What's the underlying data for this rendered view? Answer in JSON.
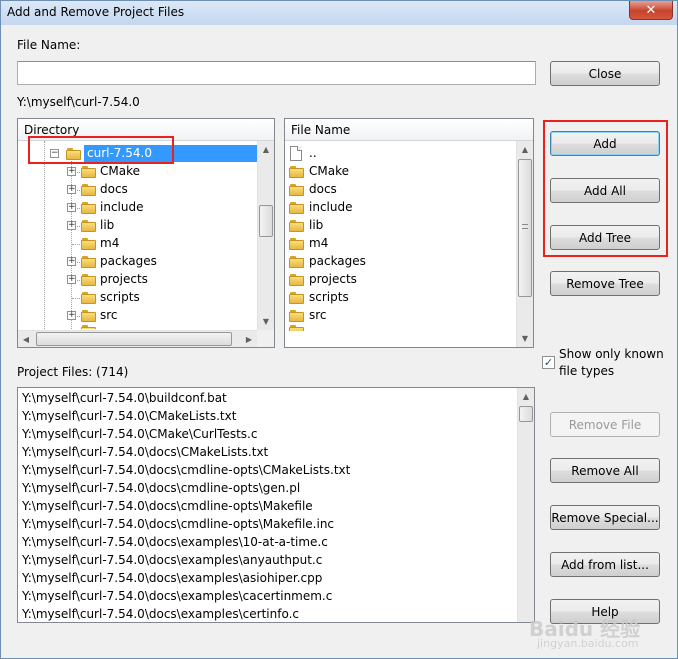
{
  "window": {
    "title": "Add and Remove Project Files",
    "close_glyph": "✕"
  },
  "file_name": {
    "label": "File Name:",
    "value": ""
  },
  "current_path": "Y:\\myself\\curl-7.54.0",
  "directory": {
    "header": "Directory",
    "root": "curl-7.54.0",
    "items": [
      {
        "label": "CMake",
        "expandable": true
      },
      {
        "label": "docs",
        "expandable": true
      },
      {
        "label": "include",
        "expandable": true
      },
      {
        "label": "lib",
        "expandable": true
      },
      {
        "label": "m4",
        "expandable": false
      },
      {
        "label": "packages",
        "expandable": true
      },
      {
        "label": "projects",
        "expandable": true
      },
      {
        "label": "scripts",
        "expandable": false
      },
      {
        "label": "src",
        "expandable": true
      }
    ]
  },
  "file_list": {
    "header": "File Name",
    "parent": "..",
    "items": [
      "CMake",
      "docs",
      "include",
      "lib",
      "m4",
      "packages",
      "projects",
      "scripts",
      "src"
    ]
  },
  "buttons": {
    "close": "Close",
    "add": "Add",
    "add_all": "Add All",
    "add_tree": "Add Tree",
    "remove_tree": "Remove Tree",
    "remove_file": "Remove File",
    "remove_all": "Remove All",
    "remove_special": "Remove Special...",
    "add_from_list": "Add from list...",
    "help": "Help"
  },
  "show_only_known": {
    "label": "Show only known file types",
    "checked": true,
    "check_glyph": "✓"
  },
  "project_files": {
    "label": "Project Files: (714)",
    "items": [
      "Y:\\myself\\curl-7.54.0\\buildconf.bat",
      "Y:\\myself\\curl-7.54.0\\CMakeLists.txt",
      "Y:\\myself\\curl-7.54.0\\CMake\\CurlTests.c",
      "Y:\\myself\\curl-7.54.0\\docs\\CMakeLists.txt",
      "Y:\\myself\\curl-7.54.0\\docs\\cmdline-opts\\CMakeLists.txt",
      "Y:\\myself\\curl-7.54.0\\docs\\cmdline-opts\\gen.pl",
      "Y:\\myself\\curl-7.54.0\\docs\\cmdline-opts\\Makefile",
      "Y:\\myself\\curl-7.54.0\\docs\\cmdline-opts\\Makefile.inc",
      "Y:\\myself\\curl-7.54.0\\docs\\examples\\10-at-a-time.c",
      "Y:\\myself\\curl-7.54.0\\docs\\examples\\anyauthput.c",
      "Y:\\myself\\curl-7.54.0\\docs\\examples\\asiohiper.cpp",
      "Y:\\myself\\curl-7.54.0\\docs\\examples\\cacertinmem.c",
      "Y:\\myself\\curl-7.54.0\\docs\\examples\\certinfo.c"
    ]
  },
  "watermark": "Baidu 经验",
  "watermark_sub": "jingyan.baidu.com",
  "colors": {
    "annotation_red": "#e8231e",
    "selection": "#3399ff"
  }
}
